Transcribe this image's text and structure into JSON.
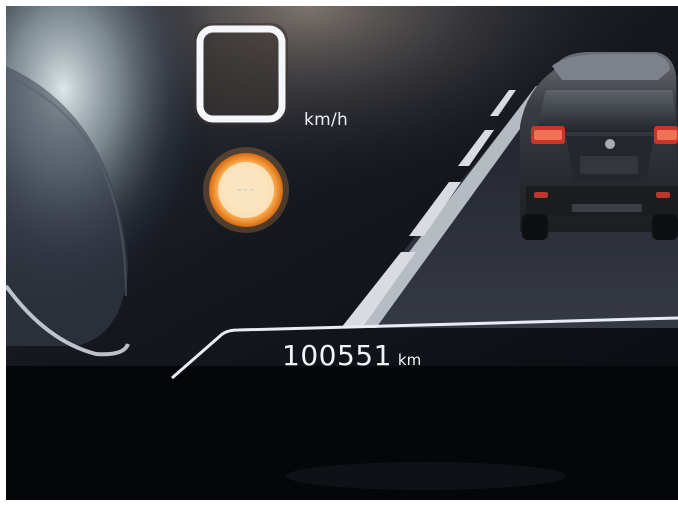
{
  "speed_display": {
    "unit": "km/h",
    "value": ""
  },
  "speed_limit_sign": {
    "text": "---"
  },
  "odometer": {
    "value": "100551",
    "unit": "km"
  },
  "colors": {
    "background": "#06070c",
    "display_text": "#f2f4f8",
    "road": "#2a2d35",
    "lane_marking": "#cfd3da",
    "limit_sign_ring": "#f08a1e",
    "vehicle_body": "#2b2d31",
    "tail_light": "#c8362a"
  },
  "icons": [
    "speed-box-icon",
    "speed-limit-sign-icon",
    "vehicle-rear-icon",
    "lane-road-icon",
    "gauge-dial-icon"
  ]
}
